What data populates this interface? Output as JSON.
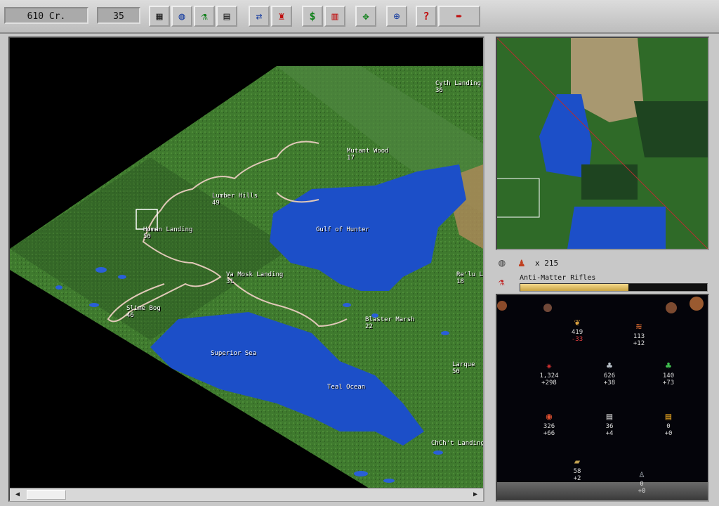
{
  "topbar": {
    "credits": "610 Cr.",
    "turn": "35",
    "buttons": [
      {
        "name": "colonies-button",
        "glyph": "▦"
      },
      {
        "name": "planets-button",
        "glyph": "◍"
      },
      {
        "name": "research-button",
        "glyph": "⚗"
      },
      {
        "name": "reports-button",
        "glyph": "▤"
      },
      {
        "name": "diplomacy-button",
        "glyph": "⇄"
      },
      {
        "name": "units-button",
        "glyph": "♜"
      },
      {
        "name": "finance-button",
        "glyph": "$"
      },
      {
        "name": "build-button",
        "glyph": "▥"
      },
      {
        "name": "trade-button",
        "glyph": "✥"
      },
      {
        "name": "zoom-button",
        "glyph": "⊕"
      },
      {
        "name": "help-button",
        "glyph": "?"
      },
      {
        "name": "end-turn-button",
        "glyph": "➨"
      }
    ]
  },
  "map": {
    "cities": [
      {
        "name": "Cyth Landing",
        "pop": "36"
      },
      {
        "name": "Mutant Wood",
        "pop": "17"
      },
      {
        "name": "Lumber Hills",
        "pop": "49"
      },
      {
        "name": "Human Landing",
        "pop": "50"
      },
      {
        "name": "Gulf of Hunter",
        "pop": ""
      },
      {
        "name": "Va Mosk Landing",
        "pop": "31"
      },
      {
        "name": "Re'lu Lg",
        "pop": "18"
      },
      {
        "name": "Slime Bog",
        "pop": "46"
      },
      {
        "name": "Blaster Marsh",
        "pop": "22"
      },
      {
        "name": "Superior Sea",
        "pop": ""
      },
      {
        "name": "Larque",
        "pop": "50"
      },
      {
        "name": "Teal Ocean",
        "pop": ""
      },
      {
        "name": "ChCh't Landing",
        "pop": ""
      }
    ]
  },
  "info": {
    "population_label": "x 215",
    "research_project": "Anti-Matter Rifles",
    "research_progress": 0.58
  },
  "resources": [
    {
      "name": "food",
      "glyph": "❦",
      "color": "#d8a040",
      "value": "419",
      "delta": "-33",
      "negative": true
    },
    {
      "name": "lumber",
      "glyph": "≋",
      "color": "#d86a30",
      "value": "113",
      "delta": "+12",
      "negative": false
    },
    {
      "name": "research",
      "glyph": "✷",
      "color": "#d03030",
      "value": "1,324",
      "delta": "+298",
      "negative": false
    },
    {
      "name": "ore",
      "glyph": "♣",
      "color": "#b8c0c8",
      "value": "626",
      "delta": "+38",
      "negative": false
    },
    {
      "name": "crystals",
      "glyph": "♣",
      "color": "#40c050",
      "value": "140",
      "delta": "+73",
      "negative": false
    },
    {
      "name": "energy",
      "glyph": "◉",
      "color": "#e05030",
      "value": "326",
      "delta": "+66",
      "negative": false
    },
    {
      "name": "metal",
      "glyph": "▤",
      "color": "#c8c8c8",
      "value": "36",
      "delta": "+4",
      "negative": false
    },
    {
      "name": "gold",
      "glyph": "▤",
      "color": "#e0a020",
      "value": "0",
      "delta": "+0",
      "negative": false
    },
    {
      "name": "textiles",
      "glyph": "▰",
      "color": "#c0a050",
      "value": "58",
      "delta": "+2",
      "negative": false
    },
    {
      "name": "artifact",
      "glyph": "♙",
      "color": "#b0b8c0",
      "value": "0",
      "delta": "+0",
      "negative": false
    }
  ]
}
